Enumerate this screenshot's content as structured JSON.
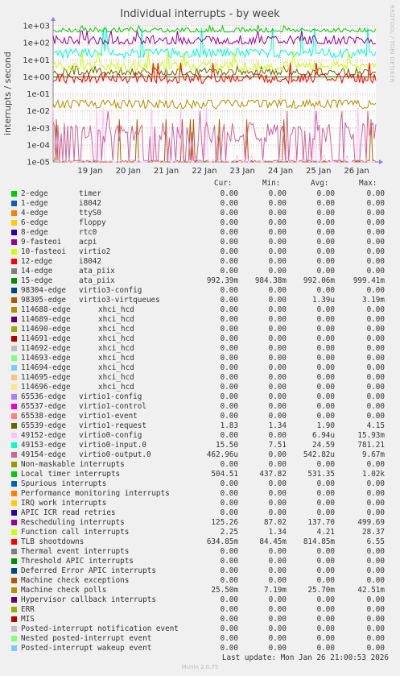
{
  "title": "Individual interrupts - by week",
  "side_brand": "RRDTOOL / TOBI OETIKER",
  "legend_columns": {
    "cur": "Cur:",
    "min": "Min:",
    "avg": "Avg:",
    "max": "Max:"
  },
  "last_update": "Last update: Mon Jan 26 21:00:53 2026",
  "munin_version": "Munin 2.0.75",
  "chart_data": {
    "type": "line",
    "ylabel": "interrupts / second",
    "y_scale": "log",
    "ylim": [
      1e-05,
      1000
    ],
    "y_ticks": [
      "1e+03",
      "1e+02",
      "1e+01",
      "1e+00",
      "1e-01",
      "1e-02",
      "1e-03",
      "1e-04",
      "1e-05"
    ],
    "x_ticks": [
      "19 Jan",
      "20 Jan",
      "21 Jan",
      "22 Jan",
      "23 Jan",
      "24 Jan",
      "25 Jan",
      "26 Jan"
    ],
    "grid": true,
    "series": [
      {
        "name": "2-edge",
        "desc": "timer",
        "color": "#00cc00",
        "cur": "0.00",
        "min": "0.00",
        "avg": "0.00",
        "max": "0.00"
      },
      {
        "name": "1-edge",
        "desc": "i8042",
        "color": "#0066b3",
        "cur": "0.00",
        "min": "0.00",
        "avg": "0.00",
        "max": "0.00"
      },
      {
        "name": "4-edge",
        "desc": "ttyS0",
        "color": "#ff8000",
        "cur": "0.00",
        "min": "0.00",
        "avg": "0.00",
        "max": "0.00"
      },
      {
        "name": "6-edge",
        "desc": "floppy",
        "color": "#ffcc00",
        "cur": "0.00",
        "min": "0.00",
        "avg": "0.00",
        "max": "0.00"
      },
      {
        "name": "8-edge",
        "desc": "rtc0",
        "color": "#330099",
        "cur": "0.00",
        "min": "0.00",
        "avg": "0.00",
        "max": "0.00"
      },
      {
        "name": "9-fasteoi",
        "desc": "acpi",
        "color": "#990099",
        "cur": "0.00",
        "min": "0.00",
        "avg": "0.00",
        "max": "0.00"
      },
      {
        "name": "10-fasteoi",
        "desc": "virtio2",
        "color": "#ccff00",
        "cur": "0.00",
        "min": "0.00",
        "avg": "0.00",
        "max": "0.00"
      },
      {
        "name": "12-edge",
        "desc": "i8042",
        "color": "#ff0000",
        "cur": "0.00",
        "min": "0.00",
        "avg": "0.00",
        "max": "0.00"
      },
      {
        "name": "14-edge",
        "desc": "ata_piix",
        "color": "#808080",
        "cur": "0.00",
        "min": "0.00",
        "avg": "0.00",
        "max": "0.00"
      },
      {
        "name": "15-edge",
        "desc": "ata_piix",
        "color": "#008f00",
        "cur": "992.39m",
        "min": "984.38m",
        "avg": "992.06m",
        "max": "999.41m"
      },
      {
        "name": "98304-edge",
        "desc": "virtio3-config",
        "color": "#00487d",
        "cur": "0.00",
        "min": "0.00",
        "avg": "0.00",
        "max": "0.00"
      },
      {
        "name": "98305-edge",
        "desc": "virtio3-virtqueues",
        "color": "#b35a00",
        "cur": "0.00",
        "min": "0.00",
        "avg": "1.39u",
        "max": "3.19m"
      },
      {
        "name": "114688-edge",
        "desc": "xhci_hcd",
        "color": "#b38f00",
        "cur": "0.00",
        "min": "0.00",
        "avg": "0.00",
        "max": "0.00"
      },
      {
        "name": "114689-edge",
        "desc": "xhci_hcd",
        "color": "#6b006b",
        "cur": "0.00",
        "min": "0.00",
        "avg": "0.00",
        "max": "0.00"
      },
      {
        "name": "114690-edge",
        "desc": "xhci_hcd",
        "color": "#8fb300",
        "cur": "0.00",
        "min": "0.00",
        "avg": "0.00",
        "max": "0.00"
      },
      {
        "name": "114691-edge",
        "desc": "xhci_hcd",
        "color": "#b30000",
        "cur": "0.00",
        "min": "0.00",
        "avg": "0.00",
        "max": "0.00"
      },
      {
        "name": "114692-edge",
        "desc": "xhci_hcd",
        "color": "#bebebe",
        "cur": "0.00",
        "min": "0.00",
        "avg": "0.00",
        "max": "0.00"
      },
      {
        "name": "114693-edge",
        "desc": "xhci_hcd",
        "color": "#80ff80",
        "cur": "0.00",
        "min": "0.00",
        "avg": "0.00",
        "max": "0.00"
      },
      {
        "name": "114694-edge",
        "desc": "xhci_hcd",
        "color": "#80c9ff",
        "cur": "0.00",
        "min": "0.00",
        "avg": "0.00",
        "max": "0.00"
      },
      {
        "name": "114695-edge",
        "desc": "xhci_hcd",
        "color": "#ffc080",
        "cur": "0.00",
        "min": "0.00",
        "avg": "0.00",
        "max": "0.00"
      },
      {
        "name": "114696-edge",
        "desc": "xhci_hcd",
        "color": "#ffe680",
        "cur": "0.00",
        "min": "0.00",
        "avg": "0.00",
        "max": "0.00"
      },
      {
        "name": "65536-edge",
        "desc": "virtio1-config",
        "color": "#aa80ff",
        "cur": "0.00",
        "min": "0.00",
        "avg": "0.00",
        "max": "0.00"
      },
      {
        "name": "65537-edge",
        "desc": "virtio1-control",
        "color": "#ee00cc",
        "cur": "0.00",
        "min": "0.00",
        "avg": "0.00",
        "max": "0.00"
      },
      {
        "name": "65538-edge",
        "desc": "virtio1-event",
        "color": "#ff8080",
        "cur": "0.00",
        "min": "0.00",
        "avg": "0.00",
        "max": "0.00"
      },
      {
        "name": "65539-edge",
        "desc": "virtio1-request",
        "color": "#666600",
        "cur": "1.83",
        "min": "1.34",
        "avg": "1.90",
        "max": "4.15"
      },
      {
        "name": "49152-edge",
        "desc": "virtio0-config",
        "color": "#ffbfff",
        "cur": "0.00",
        "min": "0.00",
        "avg": "6.94u",
        "max": "15.93m"
      },
      {
        "name": "49153-edge",
        "desc": "virtio0-input.0",
        "color": "#00ffcc",
        "cur": "15.50",
        "min": "7.51",
        "avg": "24.59",
        "max": "781.21"
      },
      {
        "name": "49154-edge",
        "desc": "virtio0-output.0",
        "color": "#cc6699",
        "cur": "462.96u",
        "min": "0.00",
        "avg": "542.82u",
        "max": "9.67m"
      },
      {
        "name": "Non-maskable interrupts",
        "desc": "",
        "color": "#999900",
        "cur": "0.00",
        "min": "0.00",
        "avg": "0.00",
        "max": "0.00"
      },
      {
        "name": "Local timer interrupts",
        "desc": "",
        "color": "#00cc00",
        "cur": "504.51",
        "min": "437.82",
        "avg": "531.35",
        "max": "1.02k"
      },
      {
        "name": "Spurious interrupts",
        "desc": "",
        "color": "#0066b3",
        "cur": "0.00",
        "min": "0.00",
        "avg": "0.00",
        "max": "0.00"
      },
      {
        "name": "Performance monitoring interrupts",
        "desc": "",
        "color": "#ff8000",
        "cur": "0.00",
        "min": "0.00",
        "avg": "0.00",
        "max": "0.00"
      },
      {
        "name": "IRQ work interrupts",
        "desc": "",
        "color": "#ffcc00",
        "cur": "0.00",
        "min": "0.00",
        "avg": "0.00",
        "max": "0.00"
      },
      {
        "name": "APIC ICR read retries",
        "desc": "",
        "color": "#330099",
        "cur": "0.00",
        "min": "0.00",
        "avg": "0.00",
        "max": "0.00"
      },
      {
        "name": "Rescheduling interrupts",
        "desc": "",
        "color": "#990099",
        "cur": "125.26",
        "min": "87.02",
        "avg": "137.70",
        "max": "499.69"
      },
      {
        "name": "Function call interrupts",
        "desc": "",
        "color": "#ccff00",
        "cur": "2.25",
        "min": "1.34",
        "avg": "4.21",
        "max": "28.37"
      },
      {
        "name": "TLB shootdowns",
        "desc": "",
        "color": "#ff0000",
        "cur": "634.85m",
        "min": "84.45m",
        "avg": "814.85m",
        "max": "6.55"
      },
      {
        "name": "Thermal event interrupts",
        "desc": "",
        "color": "#808080",
        "cur": "0.00",
        "min": "0.00",
        "avg": "0.00",
        "max": "0.00"
      },
      {
        "name": "Threshold APIC interrupts",
        "desc": "",
        "color": "#008f00",
        "cur": "0.00",
        "min": "0.00",
        "avg": "0.00",
        "max": "0.00"
      },
      {
        "name": "Deferred Error APIC interrupts",
        "desc": "",
        "color": "#00487d",
        "cur": "0.00",
        "min": "0.00",
        "avg": "0.00",
        "max": "0.00"
      },
      {
        "name": "Machine check exceptions",
        "desc": "",
        "color": "#b35a00",
        "cur": "0.00",
        "min": "0.00",
        "avg": "0.00",
        "max": "0.00"
      },
      {
        "name": "Machine check polls",
        "desc": "",
        "color": "#b38f00",
        "cur": "25.50m",
        "min": "7.19m",
        "avg": "25.70m",
        "max": "42.51m"
      },
      {
        "name": "Hypervisor callback interrupts",
        "desc": "",
        "color": "#6b006b",
        "cur": "0.00",
        "min": "0.00",
        "avg": "0.00",
        "max": "0.00"
      },
      {
        "name": "ERR",
        "desc": "",
        "color": "#8fb300",
        "cur": "0.00",
        "min": "0.00",
        "avg": "0.00",
        "max": "0.00"
      },
      {
        "name": "MIS",
        "desc": "",
        "color": "#b30000",
        "cur": "0.00",
        "min": "0.00",
        "avg": "0.00",
        "max": "0.00"
      },
      {
        "name": "Posted-interrupt notification event",
        "desc": "",
        "color": "#bebebe",
        "cur": "0.00",
        "min": "0.00",
        "avg": "0.00",
        "max": "0.00"
      },
      {
        "name": "Nested posted-interrupt event",
        "desc": "",
        "color": "#80ff80",
        "cur": "0.00",
        "min": "0.00",
        "avg": "0.00",
        "max": "0.00"
      },
      {
        "name": "Posted-interrupt wakeup event",
        "desc": "",
        "color": "#80c9ff",
        "cur": "0.00",
        "min": "0.00",
        "avg": "0.00",
        "max": "0.00"
      }
    ]
  }
}
